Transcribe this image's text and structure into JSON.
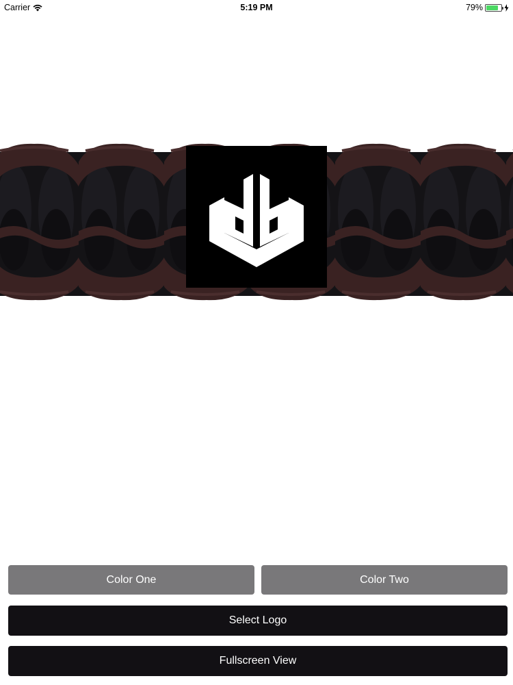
{
  "status_bar": {
    "carrier": "Carrier",
    "time": "5:19 PM",
    "battery_percent": "79%",
    "battery_level": 0.79,
    "charging": true
  },
  "preview": {
    "cord_color_one": "#3a2222",
    "cord_color_two": "#141316",
    "logo_background": "#000000",
    "logo_foreground": "#ffffff",
    "logo_icon": "db-shield-logo-icon"
  },
  "buttons": {
    "color_one": "Color One",
    "color_two": "Color Two",
    "select_logo": "Select Logo",
    "fullscreen_view": "Fullscreen View"
  },
  "colors": {
    "button_gray": "#79787a",
    "button_dark": "#121014",
    "battery_green": "#4cd964"
  }
}
